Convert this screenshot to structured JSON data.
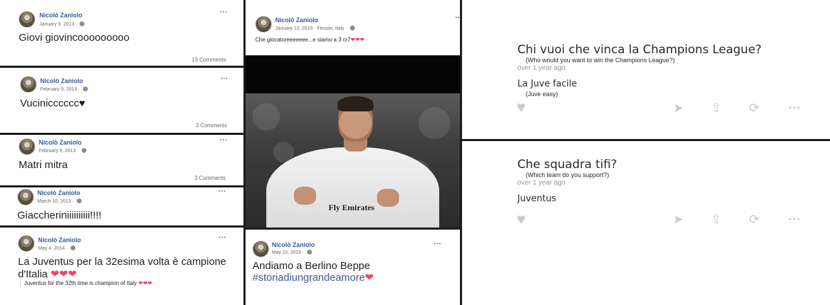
{
  "facebook_posts": [
    {
      "author": "Nicolò Zaniolo",
      "date": "January 9, 2013",
      "text": "Giovi giovincooooooooo",
      "comments": "13 Comments"
    },
    {
      "author": "Nicolò Zaniolo",
      "date": "February 9, 2013",
      "text": "Vucinicccccc♥",
      "comments": "3 Comments"
    },
    {
      "author": "Nicolò Zaniolo",
      "date": "February 9, 2013",
      "text": "Matri mitra",
      "comments": "3 Comments"
    },
    {
      "author": "Nicolò Zaniolo",
      "date": "March 10, 2013",
      "text": "Giaccheriniiiiiiiiii!!!!"
    },
    {
      "author": "Nicolò Zaniolo",
      "date": "May 4, 2014",
      "text_line1": "La Juventus per la 32esima volta è campione",
      "text_line2": "d'Italia",
      "hearts": "❤❤❤",
      "translation": "Juventus for the 32th time is champion of Italy",
      "translation_hearts": "❤❤❤"
    },
    {
      "author": "Nicolò Zaniolo",
      "date": "January 12, 2015 · Fiesole, Italy ·",
      "text": "Che giocatoreeeeeee...e siamo a 3 cr7",
      "hearts": "❤❤❤"
    },
    {
      "author": "Nicolò Zaniolo",
      "date": "May 13, 2015 ·",
      "text": "Andiamo a Berlino Beppe",
      "hashtag": "#storiadiungrandeamore",
      "heart": "❤"
    }
  ],
  "photo": {
    "shirt_text": "Fly Emirates",
    "icon": "player-photo"
  },
  "quora_questions": [
    {
      "question": "Chi vuoi che vinca la Champions League?",
      "translation": "(Who would you want to win the Champions League?)",
      "time": "over 1 year ago",
      "answer": "La Juve facile",
      "answer_translation": "(Juve easy)"
    },
    {
      "question": "Che squadra tifi?",
      "translation": "(Which team do you support?)",
      "time": "over 1 year ago",
      "answer": "Juventus"
    }
  ],
  "icons": {
    "more": "more-dots-icon",
    "globe": "globe-icon",
    "upvote": "heart-icon",
    "send": "send-icon",
    "share": "share-icon",
    "repost": "repost-icon"
  }
}
